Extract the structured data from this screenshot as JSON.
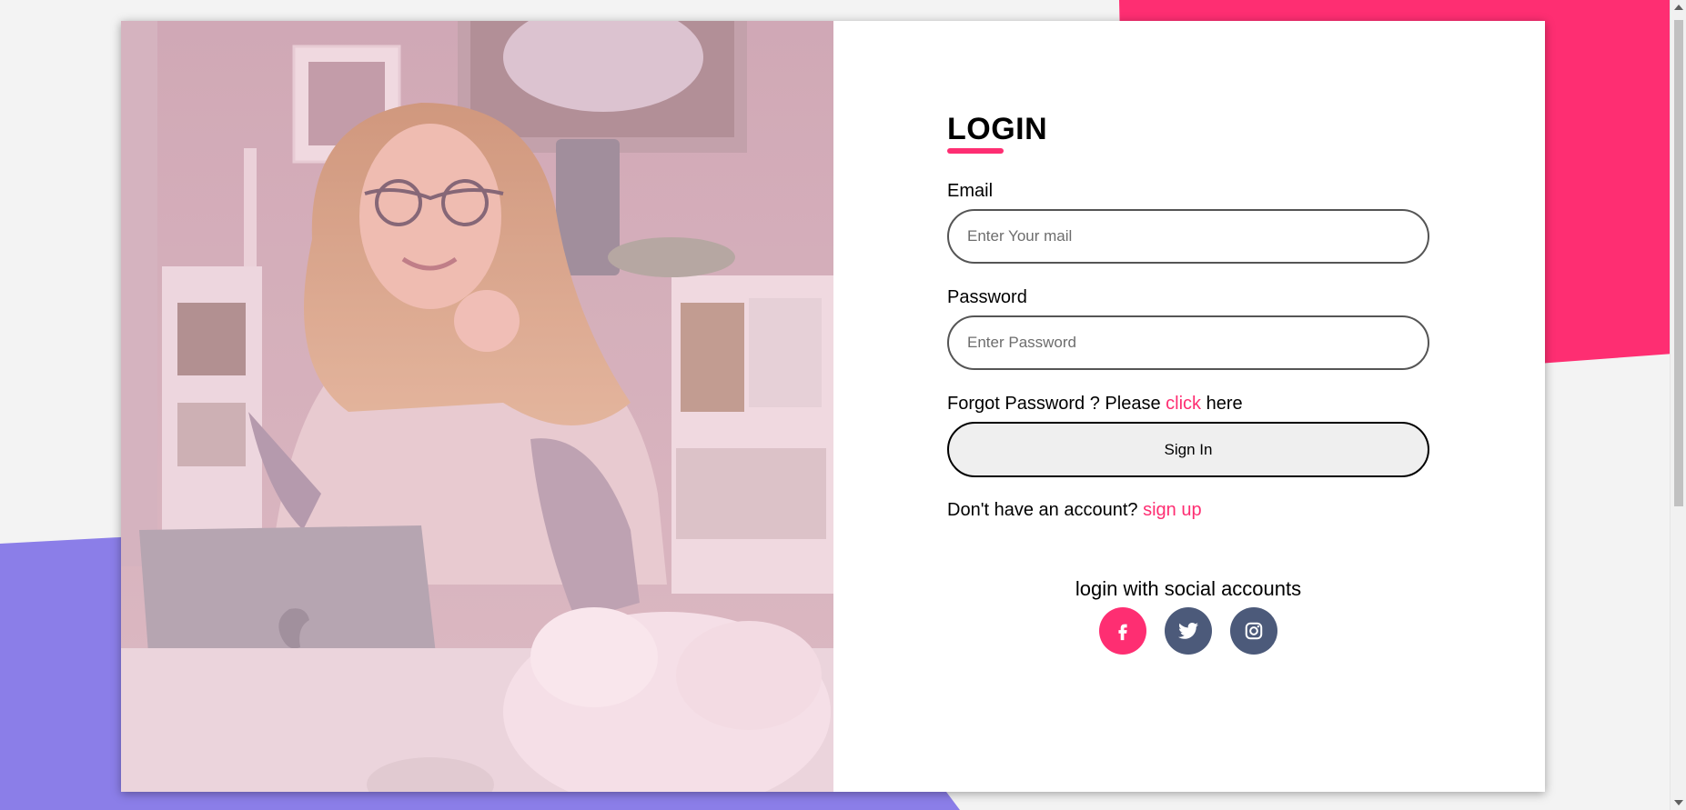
{
  "login": {
    "title": "LOGIN",
    "email_label": "Email",
    "email_placeholder": "Enter Your mail",
    "email_value": "",
    "password_label": "Password",
    "password_placeholder": "Enter Password",
    "password_value": "",
    "forgot_prefix": "Forgot Password ? Please ",
    "forgot_link": "click",
    "forgot_suffix": " here",
    "signin_label": "Sign In",
    "signup_prefix": "Don't have an account? ",
    "signup_link": "sign up",
    "social_title": "login with social accounts"
  },
  "social": [
    {
      "name": "facebook-icon",
      "color": "#fe2e72"
    },
    {
      "name": "twitter-icon",
      "color": "#4c5a7a"
    },
    {
      "name": "instagram-icon",
      "color": "#4c5a7a"
    }
  ],
  "colors": {
    "accent": "#fe2e72",
    "purple": "#8b7ee8",
    "social_dark": "#4c5a7a"
  }
}
